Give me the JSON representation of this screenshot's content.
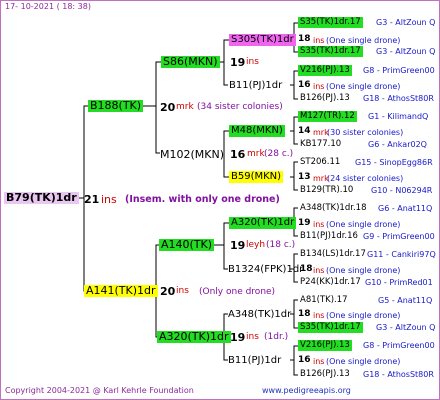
{
  "header": {
    "date": "17- 10-2021 ( 18: 38)"
  },
  "root": {
    "name": "B79(TK)1dr",
    "ins_count": "21",
    "ins_label": "ins",
    "ins_note": "(Insem. with only one drone)"
  },
  "gen1": [
    {
      "name": "B188(TK)",
      "count": "20",
      "unit": "mrk",
      "note": "(34 sister colonies)"
    },
    {
      "name": "A141(TK)1dr",
      "count": "20",
      "unit": "ins",
      "note": "(Only one drone)"
    }
  ],
  "gen2": [
    {
      "name": "S86(MKN)",
      "count": "19",
      "unit": "ins",
      "note": ""
    },
    {
      "name": "M102(MKN)",
      "count": "16",
      "unit": "mrk",
      "note": "(28 c.)"
    },
    {
      "name": "A140(TK)",
      "count": "19",
      "unit": "leyh",
      "note": "(18 c.)"
    },
    {
      "name": "A320(TK)1dr",
      "count": "19",
      "unit": "ins",
      "note": "(1dr.)"
    }
  ],
  "gen3": [
    {
      "name": "S305(TK)1dr",
      "count": "18",
      "unit": "ins",
      "note": "(One single drone)"
    },
    {
      "name": "B11(PJ)1dr",
      "count": "16",
      "unit": "ins",
      "note": "(One single drone)"
    },
    {
      "name": "M48(MKN)",
      "count": "14",
      "unit": "mrk",
      "note": "(30 sister colonies)"
    },
    {
      "name": "B59(MKN)",
      "count": "13",
      "unit": "mrk",
      "note": "(24 sister colonies)"
    },
    {
      "name": "A320(TK)1dr",
      "count": "19",
      "unit": "ins",
      "note": "(One single drone)"
    },
    {
      "name": "B1324(FPK)1dr",
      "count": "18",
      "unit": "ins",
      "note": "(One single drone)"
    },
    {
      "name": "A348(TK)1dr",
      "count": "18",
      "unit": "ins",
      "note": "(One single drone)"
    },
    {
      "name": "B11(PJ)1dr",
      "count": "16",
      "unit": "ins",
      "note": "(One single drone)"
    }
  ],
  "gen4": [
    {
      "name": "S35(TK)1dr.17",
      "info": "G3 - AltZoun Q"
    },
    {
      "name": "S35(TK)1dr.17",
      "info": "G3 - AltZoun Q"
    },
    {
      "name": "V216(PJ).13",
      "info": "G8 - PrimGreen00"
    },
    {
      "name": "B126(PJ).13",
      "info": "G18 - AthosSt80R"
    },
    {
      "name": "M127(TR).12",
      "info": "G1 - KilimandQ"
    },
    {
      "name": "KB177.10",
      "info": "G6 - Ankar02Q"
    },
    {
      "name": "ST206.11",
      "info": "G15 - SinopEgg86R"
    },
    {
      "name": "B129(TR).10",
      "info": "G10 - N06294R"
    },
    {
      "name": "A348(TK)1dr.18",
      "info": "G6 - Anat11Q"
    },
    {
      "name": "B11(PJ)1dr.16",
      "info": "G9 - PrimGreen00"
    },
    {
      "name": "B134(LS)1dr.17",
      "info": "G11 - Cankiri97Q"
    },
    {
      "name": "P24(KK)1dr.17",
      "info": "G10 - PrimRed01"
    },
    {
      "name": "A81(TK).17",
      "info": "G5 - Anat11Q"
    },
    {
      "name": "S35(TK)1dr.17",
      "info": "G3 - AltZoun Q"
    },
    {
      "name": "V216(PJ).13",
      "info": "G8 - PrimGreen00"
    },
    {
      "name": "B126(PJ).13",
      "info": "G18 - AthosSt80R"
    }
  ],
  "footer": {
    "copyright": "Copyright 2004-2021 @ Karl Kehrle Foundation",
    "site": "www.pedigreeapis.org"
  }
}
